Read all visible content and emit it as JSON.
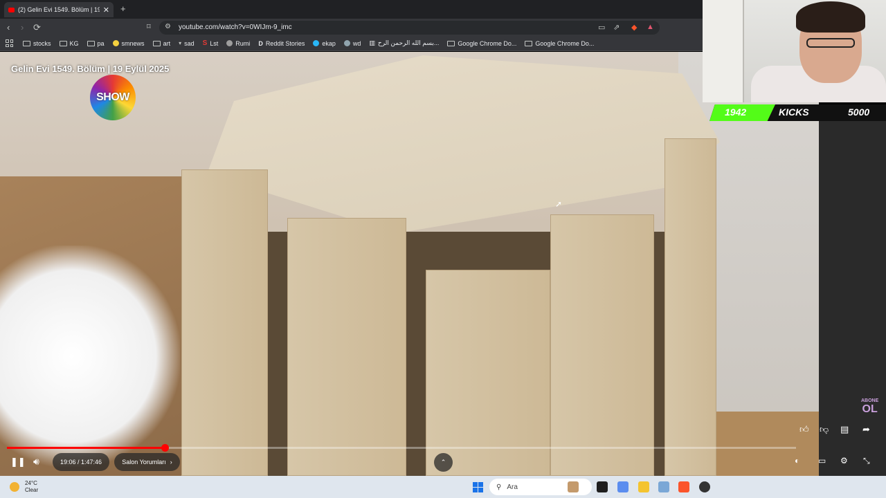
{
  "browser": {
    "tab_title": "(2) Gelin Evi 1549. Bölüm | 19",
    "tab_close": "✕",
    "new_tab": "+",
    "url": "youtube.com/watch?v=0WIJm-9_imc",
    "bookmarks": [
      "stocks",
      "KG",
      "pa",
      "smnews",
      "art",
      "sad",
      "Lst",
      "Rumi",
      "Reddit Stories",
      "ekap",
      "wd",
      "بسم الله الرحمن الرح...",
      "Google Chrome Do...",
      "Google Chrome Do..."
    ]
  },
  "video": {
    "title": "Gelin Evi 1549. Bölüm | 19 Eylül 2025",
    "channel_logo": "SHOW",
    "time": "19:06 / 1:47:46",
    "chapter": "Salon Yorumları",
    "progress_fraction": 0.2
  },
  "overlay": {
    "kicks_count": "1942",
    "kicks_label": "KICKS",
    "kicks_goal": "5000",
    "subscribe_top": "ABONE",
    "subscribe_bottom": "OL"
  },
  "taskbar": {
    "temperature": "24°C",
    "condition": "Clear",
    "search_placeholder": "Ara"
  },
  "colors": {
    "accent_red": "#ff0000",
    "kick_green": "#53fc18"
  }
}
